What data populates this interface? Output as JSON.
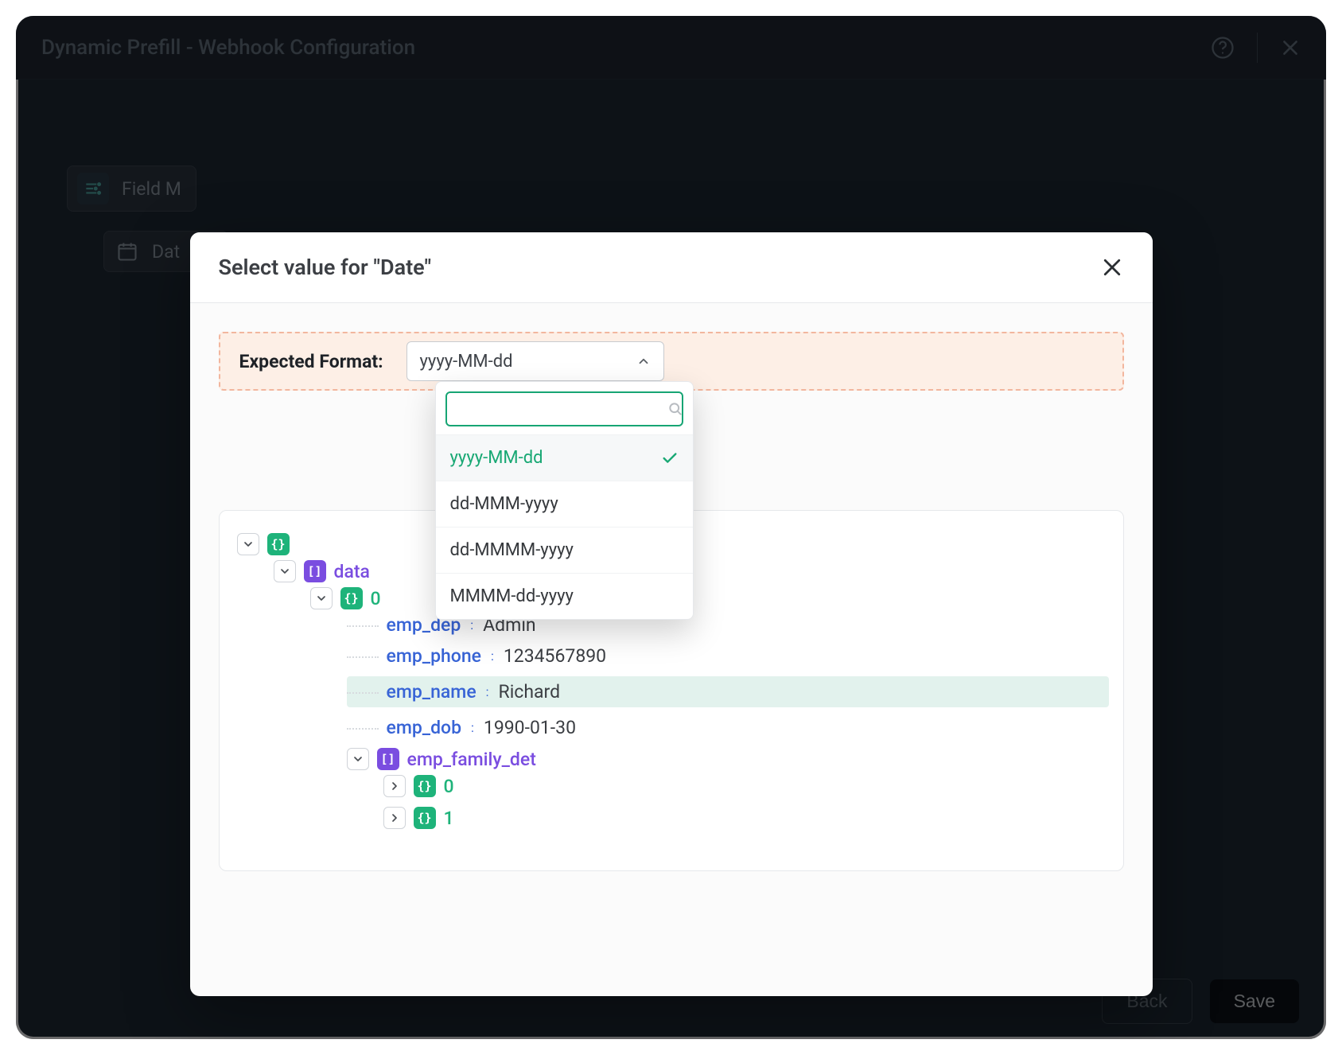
{
  "app": {
    "title": "Dynamic Prefill - Webhook Configuration"
  },
  "background": {
    "field_mapping_label": "Field M",
    "date_chip_label": "Dat"
  },
  "footer": {
    "back": "Back",
    "save": "Save"
  },
  "modal": {
    "title": "Select value for \"Date\"",
    "expected_label": "Expected Format:",
    "selected_format": "yyyy-MM-dd",
    "search_placeholder": "",
    "options": [
      "yyyy-MM-dd",
      "dd-MMM-yyyy",
      "dd-MMMM-yyyy",
      "MMMM-dd-yyyy"
    ]
  },
  "tree": {
    "root_badge": "{}",
    "data_label": "data",
    "data_badge": "[]",
    "idx0_label": "0",
    "idx0_badge": "{}",
    "fields": [
      {
        "key": "emp_dep",
        "value": "Admin",
        "highlight": false
      },
      {
        "key": "emp_phone",
        "value": "1234567890",
        "highlight": false
      },
      {
        "key": "emp_name",
        "value": "Richard",
        "highlight": true
      },
      {
        "key": "emp_dob",
        "value": "1990-01-30",
        "highlight": false
      }
    ],
    "family_label": "emp_family_det",
    "family_badge": "[]",
    "family_children": [
      {
        "badge": "{}",
        "label": "0"
      },
      {
        "badge": "{}",
        "label": "1"
      }
    ]
  }
}
